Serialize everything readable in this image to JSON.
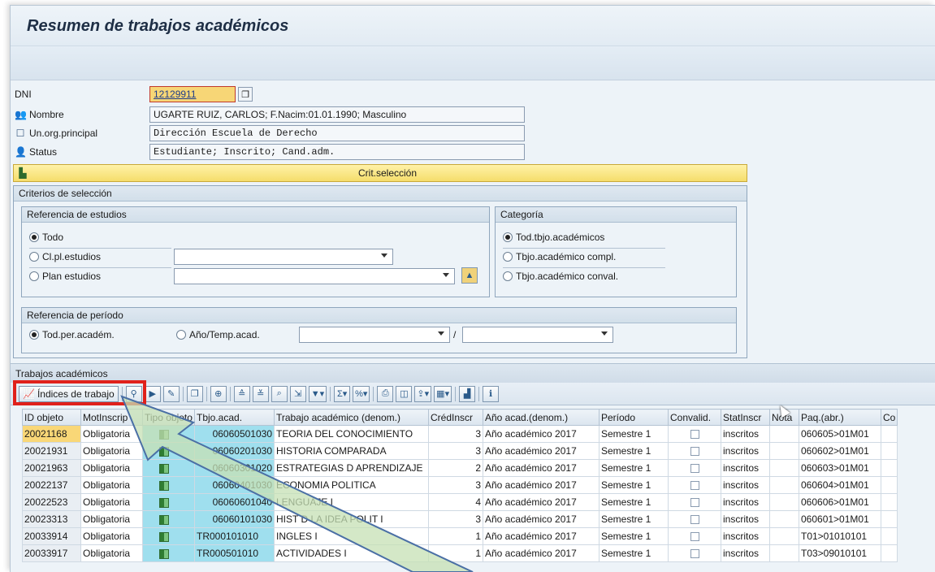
{
  "window": {
    "title": "Resumen de trabajos académicos"
  },
  "header": {
    "dni_label": "DNI",
    "dni_value": "12129911",
    "nombre_label": "Nombre",
    "nombre_value": "UGARTE RUIZ, CARLOS; F.Nacim:01.01.1990; Masculino",
    "unorg_label": "Un.org.principal",
    "unorg_value": "Dirección Escuela de Derecho",
    "status_label": "Status",
    "status_value": "Estudiante; Inscrito; Cand.adm."
  },
  "crit_button": {
    "label": "Crit.selección"
  },
  "criteria": {
    "title": "Criterios de selección",
    "estudios": {
      "title": "Referencia de estudios",
      "options": [
        "Todo",
        "Cl.pl.estudios",
        "Plan estudios"
      ],
      "selected": "Todo"
    },
    "categoria": {
      "title": "Categoría",
      "options": [
        "Tod.tbjo.académicos",
        "Tbjo.académico compl.",
        "Tbjo.académico conval."
      ],
      "selected": "Tod.tbjo.académicos"
    },
    "periodo": {
      "title": "Referencia de período",
      "options": [
        "Tod.per.académ.",
        "Año/Temp.acad."
      ],
      "selected": "Tod.per.académ.",
      "separator": "/"
    }
  },
  "works": {
    "title": "Trabajos académicos",
    "indices_button": "Índices de trabajo",
    "columns": [
      "ID objeto",
      "MotInscrip",
      "Tipo objeto",
      "Tbjo.acad.",
      "Trabajo académico (denom.)",
      "CrédInscr",
      "Año acad.(denom.)",
      "Período",
      "Convalid.",
      "StatInscr",
      "Nota",
      "Paq.(abr.)",
      "Co"
    ],
    "rows": [
      {
        "id": "20021168",
        "mot": "Obligatoria",
        "tbjo": "06060501030",
        "denom": "TEORIA DEL CONOCIMIENTO",
        "cred": "3",
        "anio": "Año académico 2017",
        "periodo": "Semestre 1",
        "stat": "inscritos",
        "paq": "060605>01M01"
      },
      {
        "id": "20021931",
        "mot": "Obligatoria",
        "tbjo": "06060201030",
        "denom": "HISTORIA COMPARADA",
        "cred": "3",
        "anio": "Año académico 2017",
        "periodo": "Semestre 1",
        "stat": "inscritos",
        "paq": "060602>01M01"
      },
      {
        "id": "20021963",
        "mot": "Obligatoria",
        "tbjo": "06060301020",
        "denom": "ESTRATEGIAS D APRENDIZAJE",
        "cred": "2",
        "anio": "Año académico 2017",
        "periodo": "Semestre 1",
        "stat": "inscritos",
        "paq": "060603>01M01"
      },
      {
        "id": "20022137",
        "mot": "Obligatoria",
        "tbjo": "06060401030",
        "denom": "ECONOMIA POLITICA",
        "cred": "3",
        "anio": "Año académico 2017",
        "periodo": "Semestre 1",
        "stat": "inscritos",
        "paq": "060604>01M01"
      },
      {
        "id": "20022523",
        "mot": "Obligatoria",
        "tbjo": "06060601040",
        "denom": "LENGUAJE I",
        "cred": "4",
        "anio": "Año académico 2017",
        "periodo": "Semestre 1",
        "stat": "inscritos",
        "paq": "060606>01M01"
      },
      {
        "id": "20023313",
        "mot": "Obligatoria",
        "tbjo": "06060101030",
        "denom": "HIST D LA IDEA POLIT I",
        "cred": "3",
        "anio": "Año académico 2017",
        "periodo": "Semestre 1",
        "stat": "inscritos",
        "paq": "060601>01M01"
      },
      {
        "id": "20033914",
        "mot": "Obligatoria",
        "tbjo": "TR000101010",
        "denom": "INGLES I",
        "cred": "1",
        "anio": "Año académico 2017",
        "periodo": "Semestre 1",
        "stat": "inscritos",
        "paq": "T01>01010101"
      },
      {
        "id": "20033917",
        "mot": "Obligatoria",
        "tbjo": "TR000501010",
        "denom": "ACTIVIDADES I",
        "cred": "1",
        "anio": "Año académico 2017",
        "periodo": "Semestre 1",
        "stat": "inscritos",
        "paq": "T03>09010101"
      }
    ]
  },
  "colors": {
    "highlight_box": "#e0211b",
    "callout_fill": "#c6e0b4",
    "crit_bar": "#f5dd6b",
    "selected_cell": "#f9d777",
    "type_cell": "#9fdfee"
  },
  "icons": [
    "copy-icon",
    "person-group-icon",
    "org-unit-icon",
    "person-status-icon",
    "selection-toggle-icon",
    "chart-icon",
    "object-type-icon",
    "checkbox-icon"
  ]
}
